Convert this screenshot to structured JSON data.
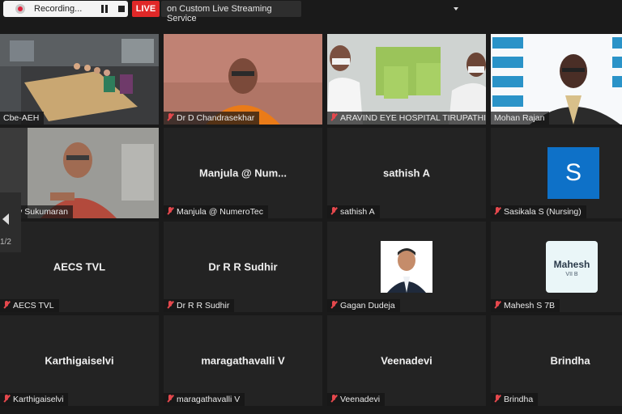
{
  "recording": {
    "label": "Recording..."
  },
  "live": {
    "badge": "LIVE",
    "stream_label": "on Custom Live Streaming Service"
  },
  "pagination": {
    "indicator": "1/2"
  },
  "colors": {
    "active_speaker_border": "#b9d85c",
    "live": "#e02828",
    "muted_mic": "#e5484d",
    "avatar_bg": "#0e71c8"
  },
  "tiles": [
    {
      "name_tag": "Cbe-AEH",
      "video": true
    },
    {
      "name_tag": "Dr D Chandrasekhar",
      "video": true
    },
    {
      "name_tag": "ARAVIND EYE HOSPITAL TIRUPATHI",
      "video": true
    },
    {
      "name_tag": "Mohan Rajan",
      "video": true
    },
    {
      "name_tag": "Rajiv Sukumaran",
      "video": true
    },
    {
      "display_name": "Manjula @ Num...",
      "name_tag": "Manjula @ NumeroTec"
    },
    {
      "display_name": "sathish A",
      "name_tag": "sathish A"
    },
    {
      "avatar_letter": "S",
      "name_tag": "Sasikala S (Nursing)"
    },
    {
      "display_name": "AECS TVL",
      "name_tag": "AECS TVL"
    },
    {
      "display_name": "Dr R R Sudhir",
      "name_tag": "Dr R R Sudhir"
    },
    {
      "name_tag": "Gagan Dudeja",
      "photo": true
    },
    {
      "name_tag": "Mahesh S 7B",
      "avatar_text": "Mahesh",
      "avatar_subtext": "VII B"
    },
    {
      "display_name": "Karthigaiselvi",
      "name_tag": "Karthigaiselvi"
    },
    {
      "display_name": "maragathavalli V",
      "name_tag": "maragathavalli V"
    },
    {
      "display_name": "Veenadevi",
      "name_tag": "Veenadevi"
    },
    {
      "display_name": "Brindha",
      "name_tag": "Brindha"
    }
  ]
}
